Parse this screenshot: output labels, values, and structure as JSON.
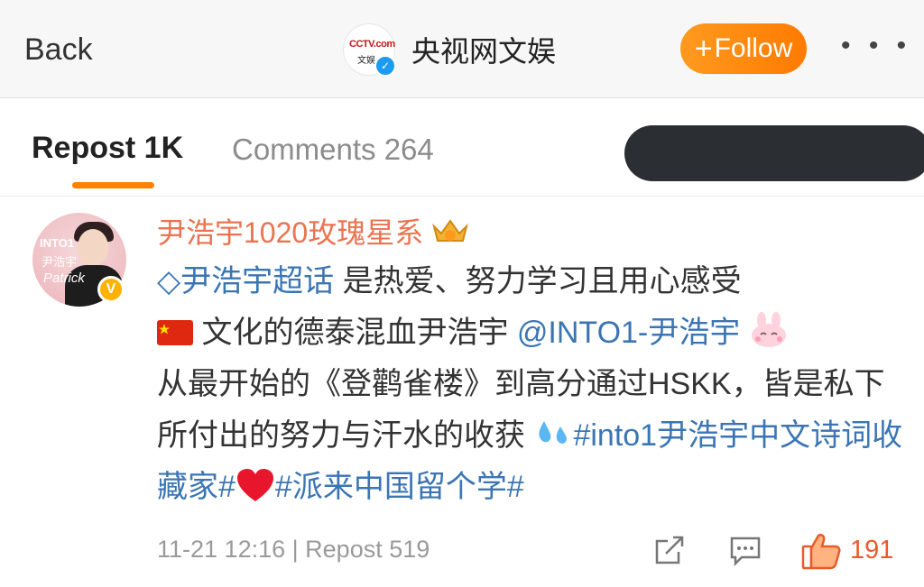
{
  "header": {
    "back_label": "Back",
    "account_name": "央视网文娱",
    "logo_text_top": "CCTV.com",
    "logo_text_bottom": "文娱",
    "follow_label": "Follow",
    "more_label": "• • •"
  },
  "tabs": {
    "repost_label": "Repost 1K",
    "comments_label": "Comments 264"
  },
  "post": {
    "username": "尹浩宇1020玫瑰星系",
    "avatar_text_1": "INTO1",
    "avatar_text_2": "尹浩宇",
    "avatar_text_3": "Patrick",
    "topic_link": "尹浩宇超话",
    "text_1": " 是热爱、努力学习且用心感受",
    "text_2": " 文化的德泰混血尹浩宇 ",
    "mention": "@INTO1-尹浩宇",
    "text_3": "从最开始的《登鹳雀楼》到高分通过HSKK，皆是私下所付出的努力与汗水的收获",
    "hashtag_1": "#into1尹浩宇中文诗词收藏家#",
    "hashtag_2": "#派来中国留个学#",
    "timestamp": "11-21 12:16",
    "separator": "|",
    "repost_count_label": "Repost 519",
    "like_count": "191"
  },
  "colors": {
    "accent": "#ff8200",
    "link": "#3b75b4",
    "username": "#eb7350",
    "muted": "#9a9a9a"
  },
  "icons": [
    "china-flag-icon",
    "bunny-emoji-icon",
    "sweat-drops-emoji-icon",
    "heart-emoji-icon",
    "share-icon",
    "comment-icon",
    "thumbs-up-icon",
    "crown-badge-icon",
    "verified-icon"
  ]
}
